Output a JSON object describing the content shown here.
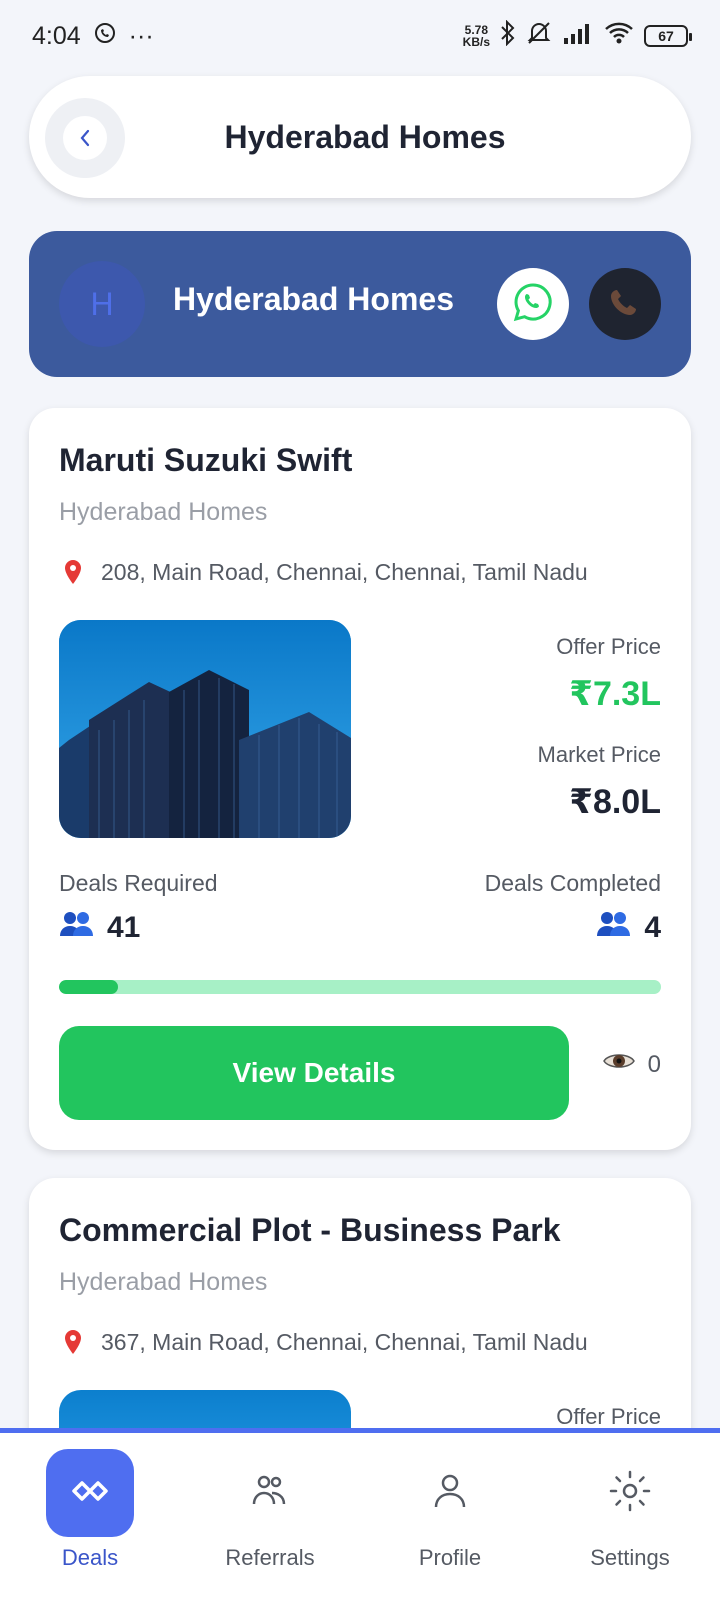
{
  "status": {
    "time": "4:04",
    "netspeed_top": "5.78",
    "netspeed_bottom": "KB/s",
    "battery": "67"
  },
  "header": {
    "title": "Hyderabad Homes"
  },
  "vendor": {
    "avatar_letter": "H",
    "name": "Hyderabad Homes"
  },
  "deals": [
    {
      "title": "Maruti Suzuki Swift",
      "company": "Hyderabad Homes",
      "address": "208, Main Road, Chennai, Chennai, Tamil Nadu",
      "offer_price_label": "Offer Price",
      "offer_price": "₹7.3L",
      "market_price_label": "Market Price",
      "market_price": "₹8.0L",
      "deals_required_label": "Deals Required",
      "deals_required": "41",
      "deals_completed_label": "Deals Completed",
      "deals_completed": "4",
      "progress_fraction": 0.0976,
      "button_label": "View Details",
      "views": "0"
    },
    {
      "title": "Commercial Plot - Business Park",
      "company": "Hyderabad Homes",
      "address": "367, Main Road, Chennai, Chennai, Tamil Nadu",
      "offer_price_label": "Offer Price"
    }
  ],
  "nav": [
    {
      "label": "Deals",
      "icon": "handshake-icon",
      "active": true
    },
    {
      "label": "Referrals",
      "icon": "users-icon",
      "active": false
    },
    {
      "label": "Profile",
      "icon": "user-icon",
      "active": false
    },
    {
      "label": "Settings",
      "icon": "sun-settings-icon",
      "active": false
    }
  ],
  "colors": {
    "primary": "#4f6ef0",
    "banner": "#3c5a9d",
    "success": "#22c55e",
    "progress_track": "#a7f0c6"
  }
}
